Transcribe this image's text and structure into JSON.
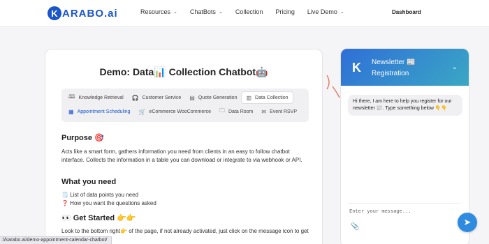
{
  "nav": {
    "logo_mark": "K",
    "logo_text": "ARABO",
    "logo_suffix": ".ai",
    "items": [
      {
        "label": "Resources",
        "dropdown": true
      },
      {
        "label": "ChatBots",
        "dropdown": true
      },
      {
        "label": "Collection",
        "dropdown": false
      },
      {
        "label": "Pricing",
        "dropdown": false
      },
      {
        "label": "Live Demo",
        "dropdown": true
      }
    ],
    "dashboard": "Dashboard"
  },
  "main": {
    "title": "Demo: Data📊 Collection Chatbot🤖",
    "tabs_row1": [
      {
        "label": "Knowledge Retrieval",
        "icon": "book-icon"
      },
      {
        "label": "Customer Service",
        "icon": "headset-icon"
      },
      {
        "label": "Quote Generation",
        "icon": "document-icon"
      },
      {
        "label": "Data Collection",
        "icon": "chart-icon"
      }
    ],
    "tabs_row2": [
      {
        "label": "Appointment Scheduling",
        "icon": "calendar-icon"
      },
      {
        "label": "eCommerce WooCommerce",
        "icon": "cart-icon"
      },
      {
        "label": "Data Room",
        "icon": "folder-icon"
      },
      {
        "label": "Event RSVP",
        "icon": "envelope-icon"
      }
    ],
    "active_tab": "Data Collection",
    "purpose_heading": "Purpose 🎯",
    "purpose_text": "Acts like a smart form, gathers information you need from clients in an easy to follow chatbot interface. Collects the information in a table you can download or integrate to via webhook or API.",
    "need_heading": "What you need",
    "need_items": [
      "🗒️ List of data points you need",
      "❓ How you want the questions asked"
    ],
    "start_heading": "👀 Get Started 👉👉",
    "start_text": "Look to the bottom right👉 of the page, if not already activated, just click on the message icon to get started👉👉"
  },
  "chat": {
    "header_logo": "K",
    "title": "Newsletter 📰 Registration",
    "message": "Hi there, I am here to help you register for our newsletter 📰. Type something below 👇👇",
    "input_placeholder": "Enter your message...",
    "accent": "#2f6fd8"
  },
  "status_url": "://karabo.ai/demo-appointment-calendar-chatbot/"
}
